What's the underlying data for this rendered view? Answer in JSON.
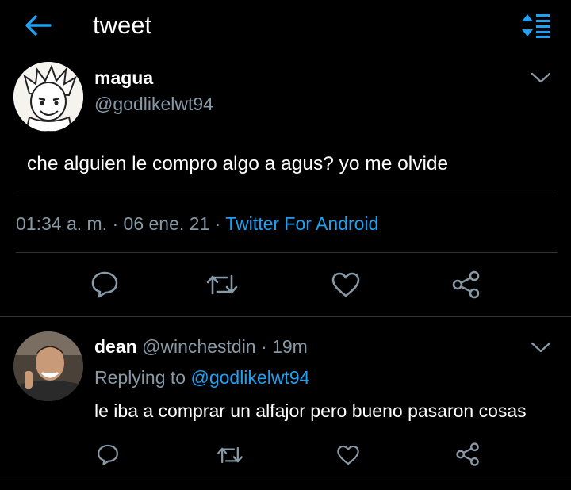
{
  "header": {
    "title": "tweet",
    "back_icon": "arrow-left-icon",
    "sort_icon": "sort-icon"
  },
  "main_tweet": {
    "display_name": "magua",
    "handle": "@godlikelwt94",
    "text": "che alguien le compro algo a agus? yo me olvide",
    "time": "01:34 a. m.",
    "separator": "·",
    "date": "06 ene. 21",
    "source": "Twitter For Android",
    "actions": [
      "reply-icon",
      "retweet-icon",
      "like-icon",
      "share-icon"
    ]
  },
  "reply": {
    "display_name": "dean",
    "handle": "@winchestdin",
    "separator": "·",
    "age": "19m",
    "replying_label": "Replying to",
    "replying_to": "@godlikelwt94",
    "text": "le iba a comprar un alfajor pero bueno pasaron cosas",
    "actions": [
      "reply-icon",
      "retweet-icon",
      "like-icon",
      "share-icon"
    ]
  },
  "colors": {
    "background": "#000000",
    "text": "#ffffff",
    "muted": "#8899a6",
    "accent": "#1da1f2",
    "divider": "#2f3336"
  }
}
